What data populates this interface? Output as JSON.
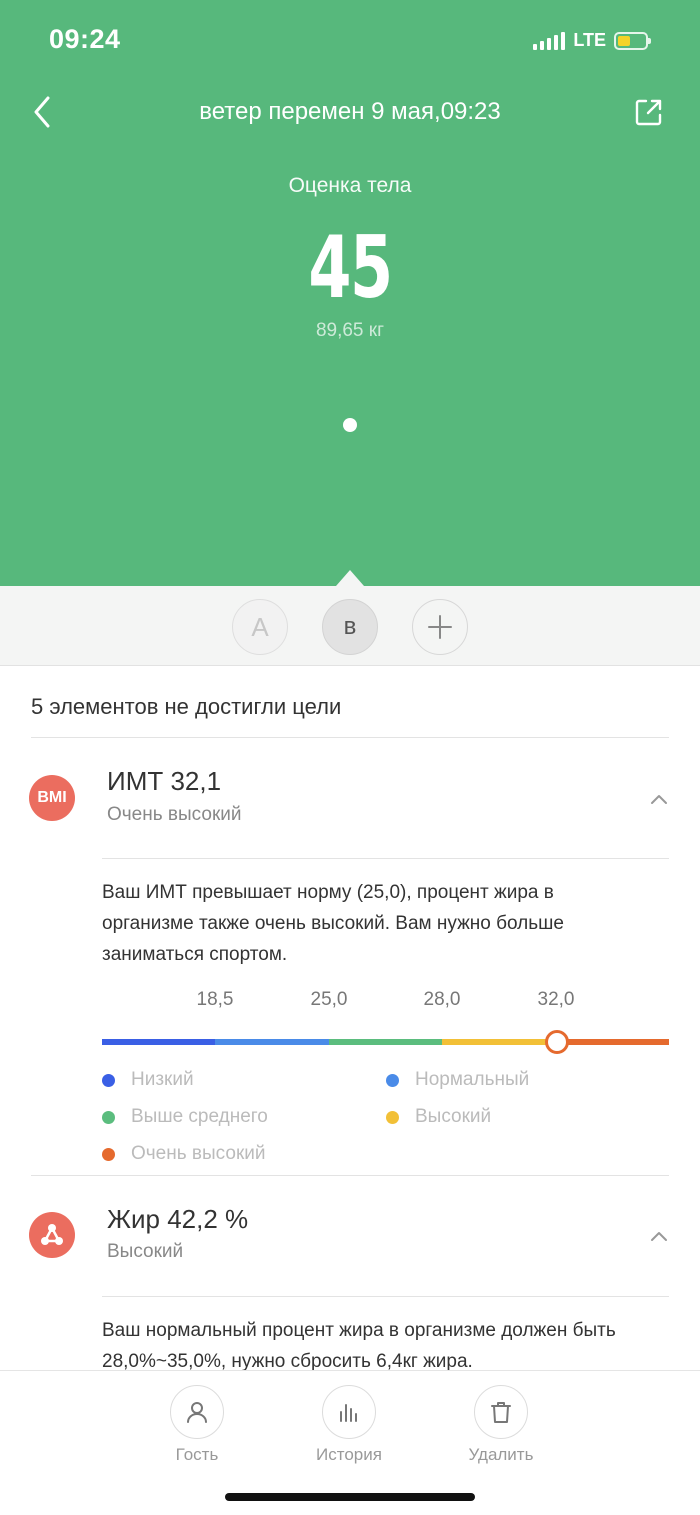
{
  "status": {
    "time": "09:24",
    "network": "LTE"
  },
  "header": {
    "title": "ветер перемен 9 мая,09:23",
    "back_icon": "chevron-left-icon",
    "share_icon": "share-icon"
  },
  "score": {
    "label": "Оценка тела",
    "value": "45",
    "weight": "89,65 кг"
  },
  "users": [
    {
      "label": "A"
    },
    {
      "label": "в"
    },
    {
      "label": "+"
    }
  ],
  "summary": {
    "title": "5 элементов не достигли цели"
  },
  "bmi": {
    "icon_text": "BMI",
    "name": "ИМТ 32,1",
    "status": "Очень высокий",
    "description": "Ваш ИМТ превышает норму (25,0), процент жира в организме также очень высокий. Вам нужно больше заниматься спортом.",
    "value": 32.1,
    "ticks": [
      "18,5",
      "25,0",
      "28,0",
      "32,0"
    ],
    "segments": [
      {
        "name": "Низкий",
        "color": "#3a5fe5"
      },
      {
        "name": "Нормальный",
        "color": "#4a8be8"
      },
      {
        "name": "Выше среднего",
        "color": "#5bbd7e"
      },
      {
        "name": "Высокий",
        "color": "#f2c037"
      },
      {
        "name": "Очень высокий",
        "color": "#e56a2e"
      }
    ]
  },
  "fat": {
    "icon": "molecule-icon",
    "name": "Жир 42,2 %",
    "status": "Высокий",
    "description": "Ваш нормальный процент жира в организме должен быть 28,0%~35,0%, нужно сбросить 6,4кг жира."
  },
  "tabs": [
    {
      "label": "Гость",
      "icon": "person-icon"
    },
    {
      "label": "История",
      "icon": "bar-chart-icon"
    },
    {
      "label": "Удалить",
      "icon": "trash-icon"
    }
  ],
  "colors": {
    "hero": "#57b87c",
    "metric_icon": "#eb6d5f"
  }
}
